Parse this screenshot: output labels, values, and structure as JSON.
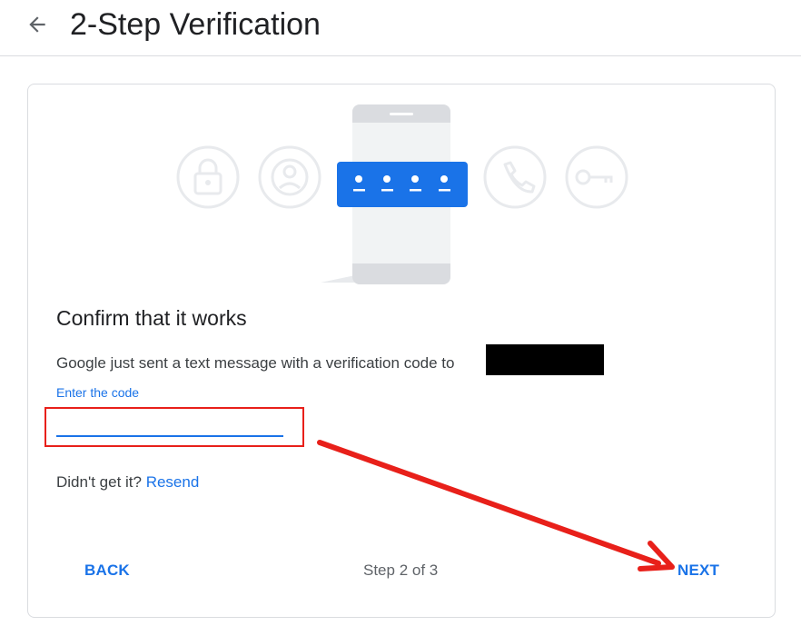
{
  "header": {
    "title": "2-Step Verification",
    "back_icon": "arrow-back-icon"
  },
  "card": {
    "illustration": {
      "icons": [
        "lock-icon",
        "account-circle-icon",
        "phone-icon",
        "key-icon"
      ],
      "code_dots": 4
    },
    "heading": "Confirm that it works",
    "message": "Google just sent a text message with a verification code to",
    "code_label": "Enter the code",
    "code_value": "",
    "resend_prefix": "Didn't get it?",
    "resend_link": "Resend"
  },
  "footer": {
    "back_label": "BACK",
    "step_text": "Step 2 of 3",
    "next_label": "NEXT"
  },
  "annotation": {
    "color": "#e8201a"
  },
  "colors": {
    "accent": "#1a73e8",
    "divider": "#dadce0"
  }
}
